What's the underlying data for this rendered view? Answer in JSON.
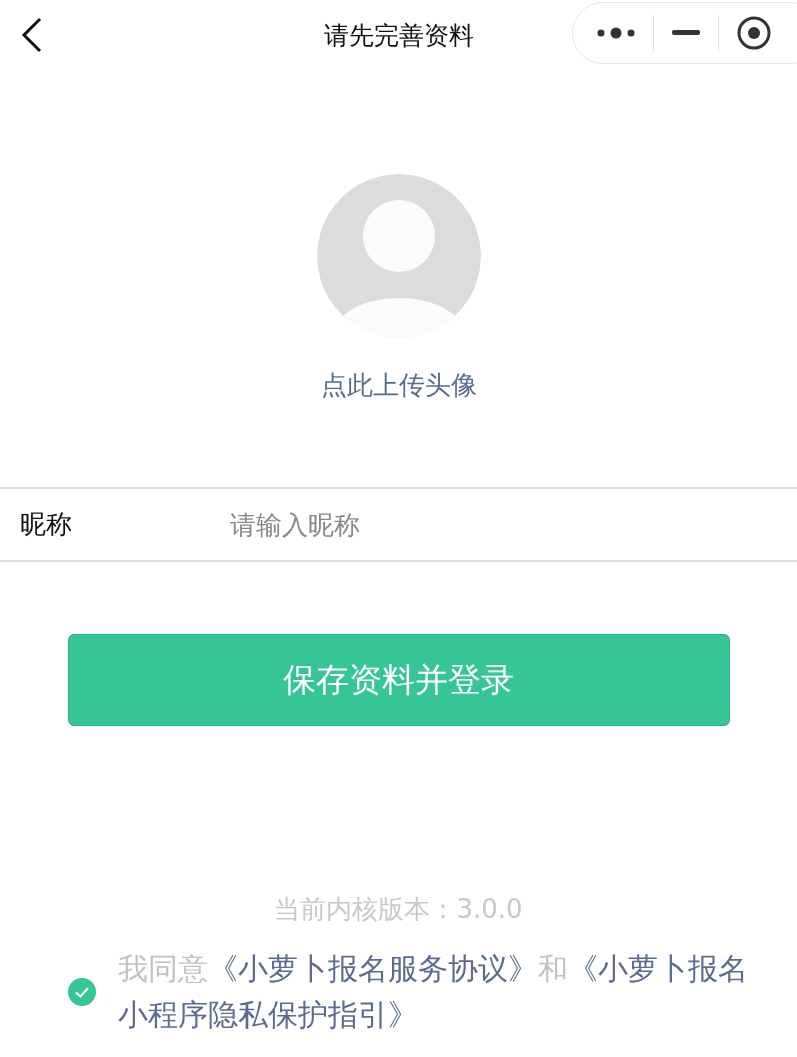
{
  "nav": {
    "title": "请先完善资料"
  },
  "avatar": {
    "label": "点此上传头像"
  },
  "form": {
    "fields": [
      {
        "label": "昵称",
        "placeholder": "请输入昵称"
      }
    ]
  },
  "submit": {
    "label": "保存资料并登录"
  },
  "version": "当前内核版本：3.0.0",
  "agreement": {
    "checked": true,
    "lines": [
      [
        {
          "kind": "text",
          "text": "我同意"
        },
        {
          "kind": "link",
          "text": "《小萝卜报名服务协议》"
        },
        {
          "kind": "text",
          "text": "和"
        },
        {
          "kind": "link",
          "text": "《小萝卜报名"
        }
      ],
      [
        {
          "kind": "link",
          "text": "小程序隐私保护指引》"
        }
      ]
    ]
  }
}
